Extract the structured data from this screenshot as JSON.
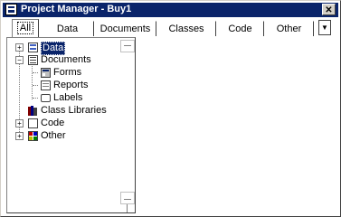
{
  "window": {
    "title": "Project Manager - Buy1",
    "close_glyph": "✕"
  },
  "tabs": [
    {
      "label": "All",
      "active": true
    },
    {
      "label": "Data",
      "active": false
    },
    {
      "label": "Documents",
      "active": false
    },
    {
      "label": "Classes",
      "active": false
    },
    {
      "label": "Code",
      "active": false
    },
    {
      "label": "Other",
      "active": false
    }
  ],
  "tab_scroll_glyph": "▼",
  "tree": {
    "items": [
      {
        "label": "Data",
        "icon": "database-icon",
        "expander": "+",
        "selected": true
      },
      {
        "label": "Documents",
        "icon": "documents-icon",
        "expander": "−",
        "selected": false
      },
      {
        "label": "Forms",
        "icon": "form-icon",
        "selected": false
      },
      {
        "label": "Reports",
        "icon": "report-icon",
        "selected": false
      },
      {
        "label": "Labels",
        "icon": "label-icon",
        "selected": false
      },
      {
        "label": "Class Libraries",
        "icon": "class-library-icon",
        "selected": false
      },
      {
        "label": "Code",
        "icon": "code-icon",
        "expander": "+",
        "selected": false
      },
      {
        "label": "Other",
        "icon": "other-icon",
        "expander": "+",
        "selected": false
      }
    ]
  },
  "colors": {
    "title_bar": "#0a246a",
    "selection": "#0a246a"
  }
}
